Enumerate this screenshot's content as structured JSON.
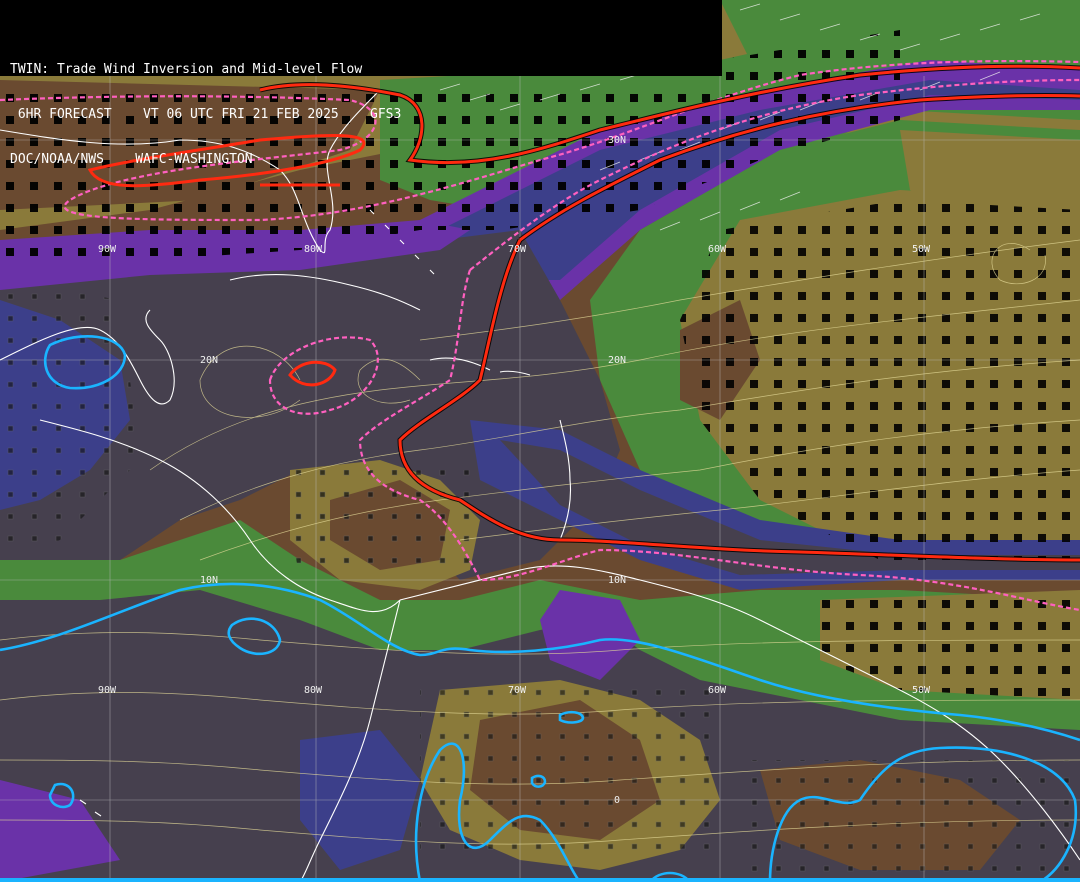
{
  "header": {
    "line1": "TWIN: Trade Wind Inversion and Mid-level Flow",
    "line2": " 6HR FORECAST    VT 06 UTC FRI 21 FEB 2025    GFS3",
    "line3": "DOC/NOAA/NWS    WAFC-WASHINGTON"
  },
  "grid_labels": {
    "lat": [
      "30N",
      "20N",
      "10N",
      "0"
    ],
    "lon": [
      "90W",
      "80W",
      "70W",
      "60W",
      "50W"
    ]
  },
  "colors": {
    "dark_stable": "#46404e",
    "blue_purple": "#3c3f8a",
    "purple": "#6a32a8",
    "green": "#4a8a3c",
    "olive": "#8a7a3a",
    "brown": "#6a4a30",
    "red_contour": "#ff2a10",
    "pink_dashed": "#ff60c0",
    "cyan_contour": "#1ab4ff",
    "coastline": "#ffffff",
    "streamlines": "#e6dc9a"
  }
}
